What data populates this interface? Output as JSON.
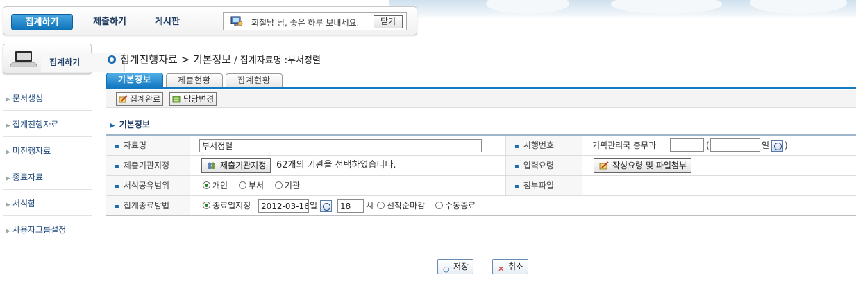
{
  "topnav": {
    "items": [
      {
        "label": "집계하기",
        "active": true
      },
      {
        "label": "제출하기",
        "active": false
      },
      {
        "label": "게시판",
        "active": false
      }
    ],
    "greeting": "회철남 님, 좋은 하루 보내세요.",
    "close_label": "닫기"
  },
  "sidebar": {
    "header": "집계하기",
    "items": [
      {
        "label": "문서생성"
      },
      {
        "label": "집계진행자료"
      },
      {
        "label": "미진행자료"
      },
      {
        "label": "종료자료"
      },
      {
        "label": "서식함"
      },
      {
        "label": "사용자그룹설정"
      }
    ]
  },
  "page": {
    "title": "집계진행자료 > 기본정보",
    "subtitle": " / 집계자료명 :부서정렬"
  },
  "tabs": [
    {
      "label": "기본정보",
      "active": true
    },
    {
      "label": "제출현황",
      "active": false
    },
    {
      "label": "집계현황",
      "active": false
    }
  ],
  "toolbar": {
    "complete_label": "집계완료",
    "change_owner_label": "담당변경"
  },
  "section_title": "기본정보",
  "form": {
    "name_label": "자료명",
    "name_value": "부서정렬",
    "enforce_no_label": "시행번호",
    "enforce_prefix": "기획관리국 총무과_",
    "enforce_paren_open": "(",
    "enforce_day_suffix": "일",
    "enforce_paren_close": ")",
    "submit_org_label": "제출기관지정",
    "submit_org_button": "제출기관지정",
    "submit_org_text": "62개의 기관을 선택하였습니다.",
    "input_guide_label": "입력요령",
    "input_guide_button": "작성요령 및 파일첨부",
    "share_scope_label": "서식공유범위",
    "share_options": [
      "개인",
      "부서",
      "기관"
    ],
    "share_selected": "개인",
    "attach_label": "첨부파일",
    "end_method_label": "집계종료방법",
    "end_option_date": "종료일지정",
    "end_date": "2012-03-16",
    "day_unit": "일",
    "end_hour": "18",
    "hour_unit": "시",
    "end_option_first": "선착순마감",
    "end_option_manual": "수동종료",
    "end_selected": "종료일지정"
  },
  "actions": {
    "save_label": "저장",
    "cancel_label": "취소"
  }
}
